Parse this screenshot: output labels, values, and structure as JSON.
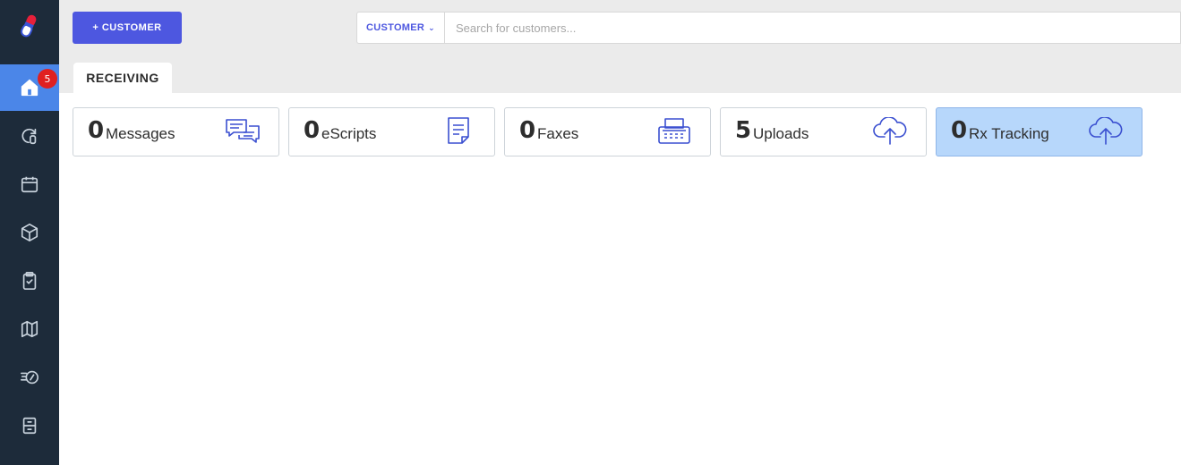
{
  "sidebar": {
    "badge_count": "5",
    "items": [
      {
        "icon": "home-icon"
      },
      {
        "icon": "refill-icon"
      },
      {
        "icon": "calendar-icon"
      },
      {
        "icon": "package-icon"
      },
      {
        "icon": "clipboard-check-icon"
      },
      {
        "icon": "map-icon"
      },
      {
        "icon": "delivery-icon"
      },
      {
        "icon": "cabinet-icon"
      }
    ]
  },
  "toolbar": {
    "add_label": "+ CUSTOMER",
    "search_type": "CUSTOMER",
    "search_placeholder": "Search for customers..."
  },
  "tabs": {
    "receiving": "RECEIVING"
  },
  "cards": [
    {
      "count": "0",
      "label": "Messages",
      "icon": "chat-icon"
    },
    {
      "count": "0",
      "label": "eScripts",
      "icon": "document-icon"
    },
    {
      "count": "0",
      "label": "Faxes",
      "icon": "fax-icon"
    },
    {
      "count": "5",
      "label": "Uploads",
      "icon": "cloud-upload-icon"
    },
    {
      "count": "0",
      "label": "Rx Tracking",
      "icon": "cloud-upload-icon",
      "selected": true
    }
  ],
  "colors": {
    "sidebar": "#1d2b3a",
    "active_nav": "#4b86e8",
    "accent": "#4d57e0",
    "badge": "#e02020",
    "selected_card": "#b7d7fb"
  }
}
